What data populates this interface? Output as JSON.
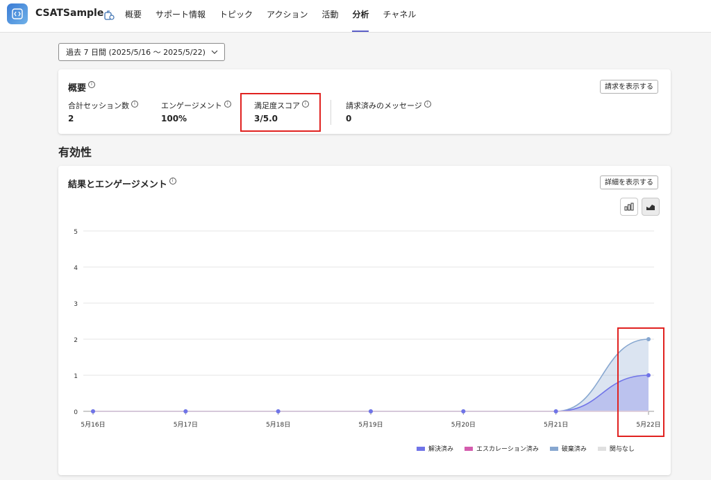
{
  "app": {
    "name": "CSATSample",
    "tabs": [
      "概要",
      "サポート情報",
      "トピック",
      "アクション",
      "活動",
      "分析",
      "チャネル"
    ],
    "active_tab": "分析"
  },
  "filter": {
    "date_range": "過去 7 日間 (2025/5/16 〜 2025/5/22)"
  },
  "summary": {
    "title": "概要",
    "billing_button": "請求を表示する",
    "metrics": [
      {
        "label": "合計セッション数",
        "value": "2"
      },
      {
        "label": "エンゲージメント",
        "value": "100%"
      },
      {
        "label": "満足度スコア",
        "value": "3/5.0"
      },
      {
        "label": "請求済みのメッセージ",
        "value": "0"
      }
    ]
  },
  "section": {
    "title": "有効性"
  },
  "outcomes": {
    "title": "結果とエンゲージメント",
    "details_button": "詳細を表示する"
  },
  "chart_data": {
    "type": "area",
    "x": [
      "5月16日",
      "5月17日",
      "5月18日",
      "5月19日",
      "5月20日",
      "5月21日",
      "5月22日"
    ],
    "ylim": [
      0,
      5
    ],
    "yticks": [
      "0",
      "1",
      "2",
      "3",
      "4",
      "5"
    ],
    "series": [
      {
        "name": "解決済み",
        "values": [
          0,
          0,
          0,
          0,
          0,
          0,
          1
        ],
        "color": "#7074e8"
      },
      {
        "name": "エスカレーション済み",
        "values": [
          0,
          0,
          0,
          0,
          0,
          0,
          0
        ],
        "color": "#d45cae"
      },
      {
        "name": "破棄済み",
        "values": [
          0,
          0,
          0,
          0,
          0,
          0,
          2
        ],
        "color": "#87a7d0"
      },
      {
        "name": "関与なし",
        "values": [
          0,
          0,
          0,
          0,
          0,
          0,
          0
        ],
        "color": "#e0e0e0"
      }
    ],
    "grid": true,
    "legend": "bottom-right"
  },
  "colors": {
    "accent": "#5b5fc7",
    "highlight": "#e0211f"
  }
}
